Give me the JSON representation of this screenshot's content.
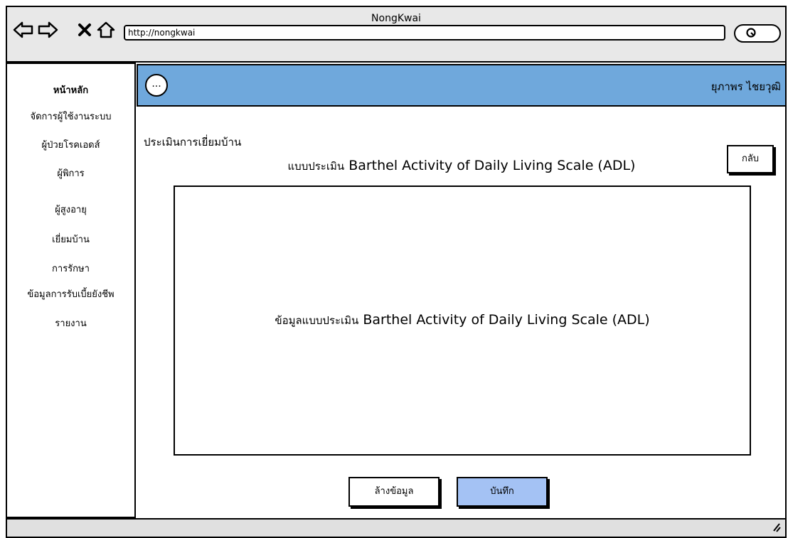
{
  "window": {
    "title": "NongKwai",
    "url": "http://nongkwai"
  },
  "browser_icons": [
    "back-arrow-icon",
    "forward-arrow-icon",
    "close-x-icon",
    "home-icon",
    "search-icon"
  ],
  "sidebar": {
    "items": [
      {
        "label": "หน้าหลัก"
      },
      {
        "label": "จัดการผู้ใช้งานระบบ"
      },
      {
        "label": "ผู้ป่วยโรคเอดส์"
      },
      {
        "label": "ผู้พิการ"
      },
      {
        "label": "ผู้สูงอายุ"
      },
      {
        "label": "เยี่ยมบ้าน"
      },
      {
        "label": "การรักษา"
      },
      {
        "label": "ข้อมูลการรับเบี้ยยังชีพ"
      },
      {
        "label": "รายงาน"
      }
    ]
  },
  "header": {
    "menu_label": "...",
    "user_name": "ยุภาพร ไชยวุฒิ",
    "color": "#6fa8dc"
  },
  "main": {
    "section_title": "ประเมินการเยี่ยมบ้าน",
    "back_label": "กลับ",
    "form_heading_prefix": "แบบประเมิน",
    "form_heading_name": "Barthel Activity of Daily Living Scale (ADL)",
    "panel_prefix": "ข้อมูลแบบประเมิน",
    "panel_name": "Barthel Activity of Daily Living Scale (ADL)",
    "clear_label": "ล้างข้อมูล",
    "save_label": "บันทึก",
    "save_color": "#a4c2f4"
  }
}
